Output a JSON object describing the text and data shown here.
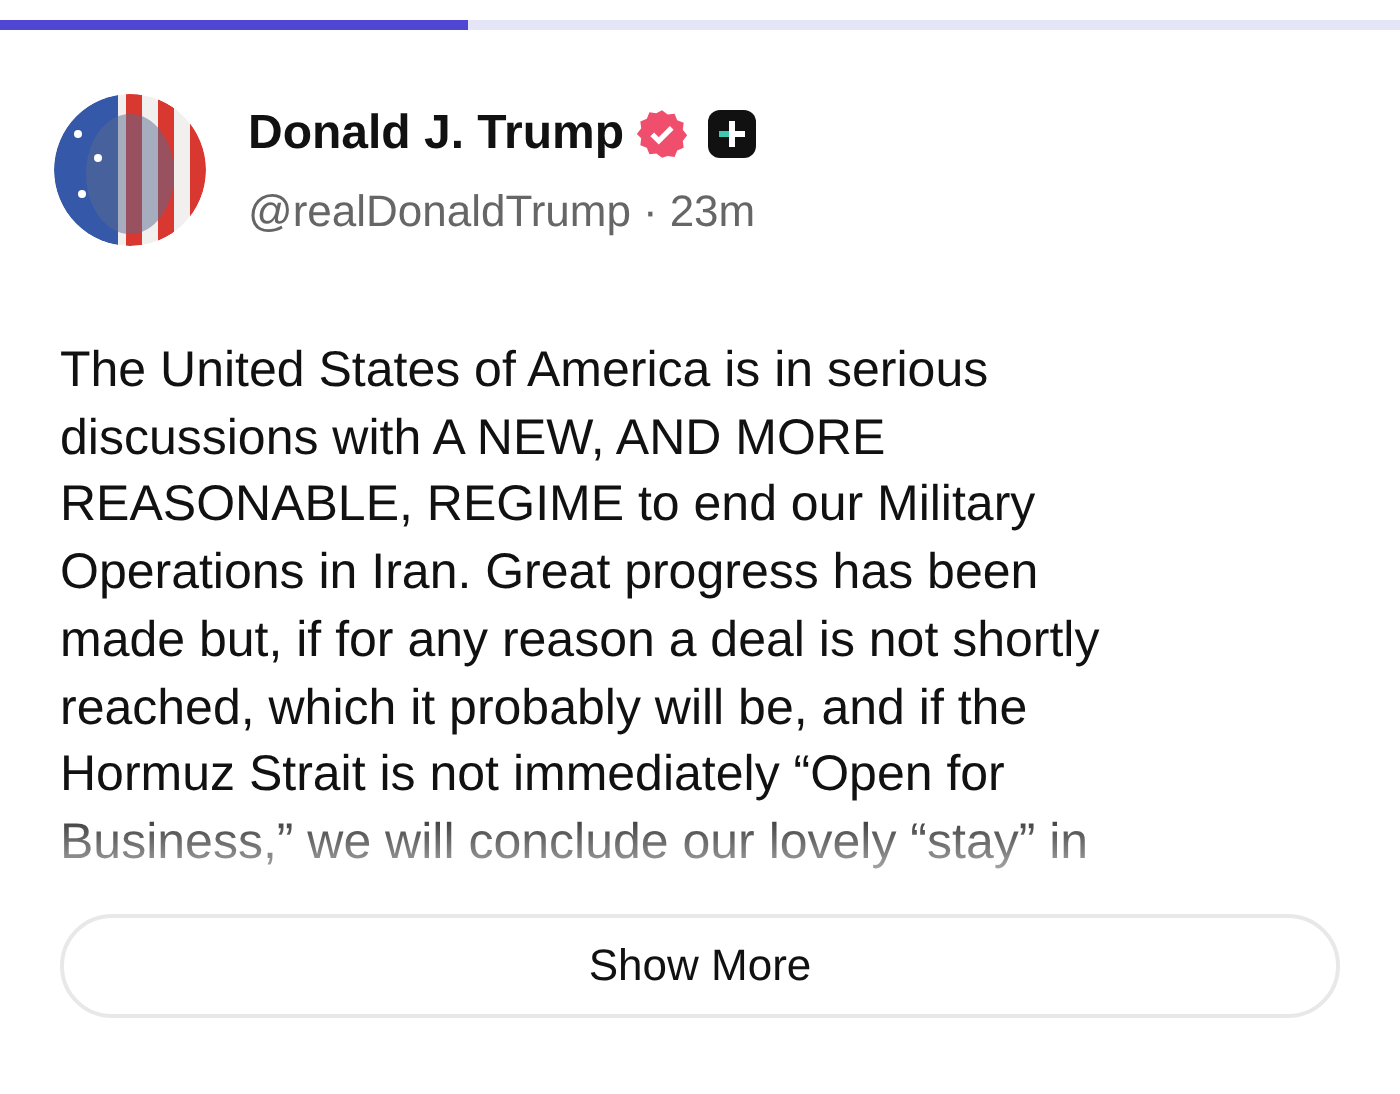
{
  "progress": {
    "level": 0.334
  },
  "post": {
    "author": "Donald J. Trump",
    "handle": "@realDonaldTrump",
    "separator": "·",
    "time": "23m",
    "text": "The United States of America is in serious\ndiscussions with A NEW, AND MORE\nREASONABLE, REGIME to end our Military\nOperations in Iran. Great progress has been\nmade but, if for any reason a deal is not shortly\nreached, which it probably will be, and if the\nHormuz Strait is not immediately “Open for\nBusiness,” we will conclude our lovely “stay” in"
  },
  "show_more": "Show More"
}
